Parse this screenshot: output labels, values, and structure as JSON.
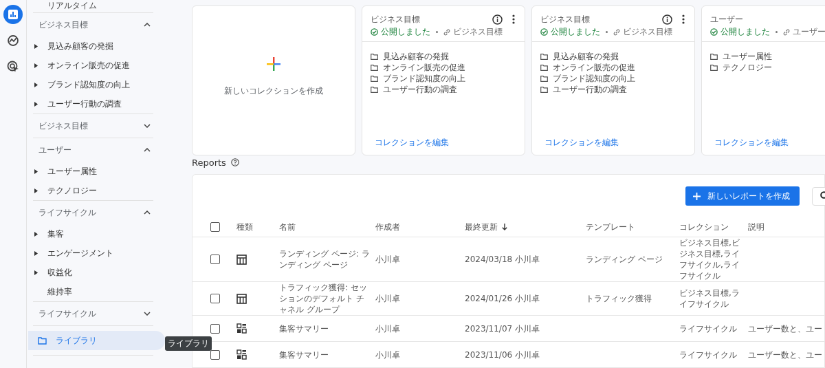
{
  "rail": [
    {
      "kind": "reports",
      "selected": true
    },
    {
      "kind": "explore",
      "selected": false
    },
    {
      "kind": "advertising",
      "selected": false
    }
  ],
  "sidebar": {
    "top_item": "リアルタイム",
    "sections": [
      {
        "title": "ビジネス目標",
        "expanded": true,
        "items": [
          {
            "label": "見込み顧客の発掘",
            "expandable": true
          },
          {
            "label": "オンライン販売の促進",
            "expandable": true
          },
          {
            "label": "ブランド認知度の向上",
            "expandable": true
          },
          {
            "label": "ユーザー行動の調査",
            "expandable": true
          }
        ]
      },
      {
        "title": "ビジネス目標",
        "expanded": false
      },
      {
        "title": "ユーザー",
        "expanded": true,
        "items": [
          {
            "label": "ユーザー属性",
            "expandable": true
          },
          {
            "label": "テクノロジー",
            "expandable": true
          }
        ]
      },
      {
        "title": "ライフサイクル",
        "expanded": true,
        "items": [
          {
            "label": "集客",
            "expandable": true
          },
          {
            "label": "エンゲージメント",
            "expandable": true
          },
          {
            "label": "収益化",
            "expandable": true
          },
          {
            "label": "維持率",
            "expandable": false
          }
        ]
      },
      {
        "title": "ライフサイクル",
        "expanded": false
      }
    ],
    "library": {
      "label": "ライブラリ",
      "selected": true
    },
    "tooltip": "ライブラリ"
  },
  "new_collection": {
    "label": "新しいコレクションを作成"
  },
  "collections": [
    {
      "title": "ビジネス目標",
      "status": "公開しました",
      "template": "ビジネス目標",
      "actions": true,
      "items": [
        "見込み顧客の発掘",
        "オンライン販売の促進",
        "ブランド認知度の向上",
        "ユーザー行動の調査"
      ],
      "edit_link": "コレクションを編集"
    },
    {
      "title": "ビジネス目標",
      "status": "公開しました",
      "template": "ビジネス目標",
      "actions": true,
      "items": [
        "見込み顧客の発掘",
        "オンライン販売の促進",
        "ブランド認知度の向上",
        "ユーザー行動の調査"
      ],
      "edit_link": "コレクションを編集"
    },
    {
      "title": "ユーザー",
      "status": "公開しました",
      "template": "ユーザー",
      "items": [
        "ユーザー属性",
        "テクノロジー"
      ],
      "edit_link": "コレクションを編集"
    }
  ],
  "reports": {
    "title": "Reports",
    "create_button": "新しいレポートを作成",
    "all_checked": false,
    "columns": [
      "種類",
      "名前",
      "作成者",
      "最終更新",
      "テンプレート",
      "コレクション",
      "説明"
    ],
    "rows": [
      {
        "checked": false,
        "kind": "table",
        "name": "ランディング ページ: ランディング ページ",
        "author": "小川卓",
        "updated": "2024/03/18 小川卓",
        "template": "ランディング ページ",
        "collection": "ビジネス目標,ビジネス目標,ライフサイクル,ライフサイクル"
      },
      {
        "checked": false,
        "kind": "table",
        "name": "トラフィック獲得: セッションのデフォルト チャネル グループ",
        "author": "小川卓",
        "updated": "2024/01/26 小川卓",
        "template": "トラフィック獲得",
        "collection": "ビジネス目標,ライフサイクル"
      },
      {
        "checked": false,
        "kind": "dashboard",
        "name": "集客サマリー",
        "author": "小川卓",
        "updated": "2023/11/07 小川卓",
        "collection": "ライフサイクル",
        "description": "ユーザー数と、ユー"
      },
      {
        "checked": false,
        "kind": "dashboard",
        "name": "集客サマリー",
        "author": "小川卓",
        "updated": "2023/11/06 小川卓",
        "collection": "ライフサイクル",
        "description": "ユーザー数と、ユー"
      }
    ]
  }
}
